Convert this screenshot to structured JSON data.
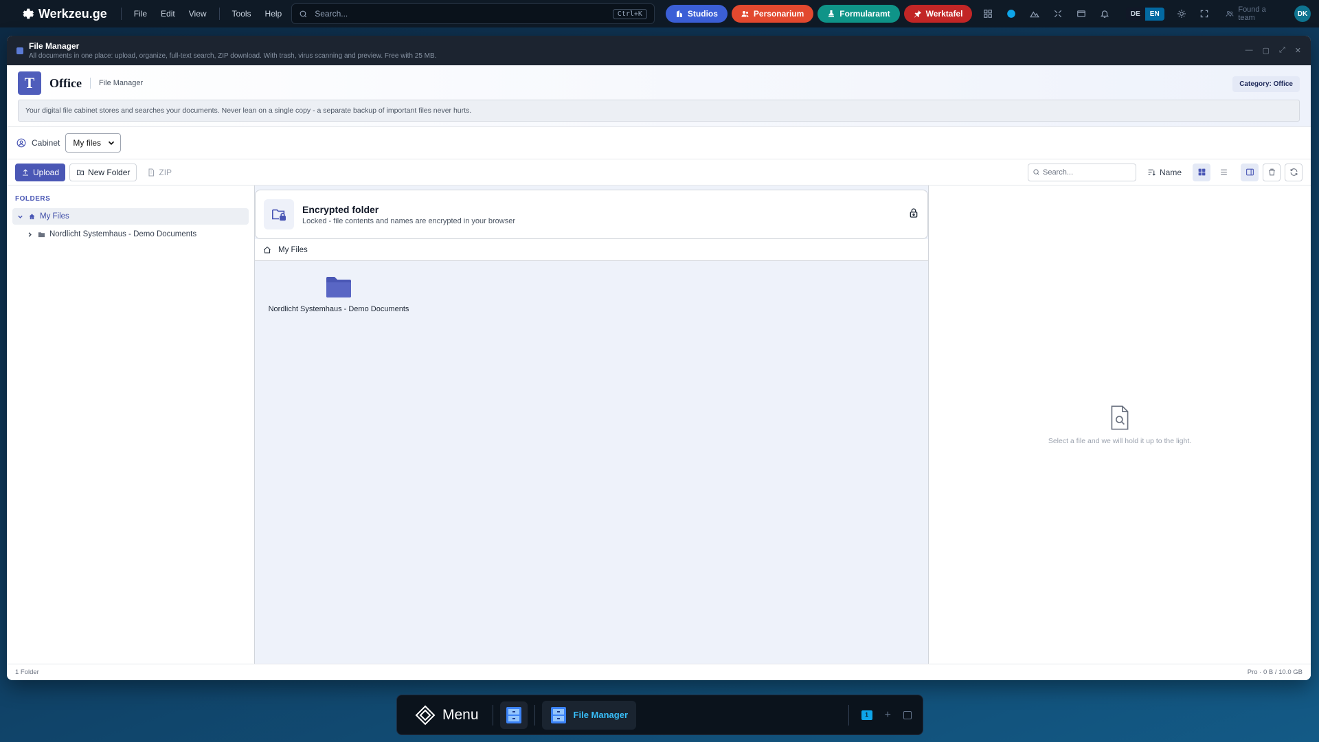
{
  "topbar": {
    "brand": "Werkzeu.ge",
    "menus": [
      "File",
      "Edit",
      "View",
      "Tools",
      "Help"
    ],
    "search_placeholder": "Search...",
    "search_shortcut": "Ctrl+K",
    "pills": [
      {
        "label": "Studios",
        "color": "#3b5fd6"
      },
      {
        "label": "Personarium",
        "color": "#e2492f"
      },
      {
        "label": "Formularamt",
        "color": "#0f9488"
      },
      {
        "label": "Werktafel",
        "color": "#c22626"
      }
    ],
    "lang_de": "DE",
    "lang_en": "EN",
    "found_team": "Found a team",
    "avatar_initials": "DK"
  },
  "window": {
    "title": "File Manager",
    "subtitle": "All documents in one place: upload, organize, full-text search, ZIP download. With trash, virus scanning and preview. Free with 25 MB."
  },
  "header": {
    "badge_letter": "T",
    "app_name": "Office",
    "app_sub": "File Manager",
    "category": "Category: Office",
    "notice": "Your digital file cabinet stores and searches your documents. Never lean on a single copy - a separate backup of important files never hurts."
  },
  "cabinet": {
    "label": "Cabinet",
    "selected": "My files"
  },
  "toolbar": {
    "upload": "Upload",
    "new_folder": "New Folder",
    "zip": "ZIP",
    "search_placeholder": "Search...",
    "sort_label": "Name"
  },
  "sidebar": {
    "title": "FOLDERS",
    "root": "My Files",
    "children": [
      "Nordlicht Systemhaus - Demo Documents"
    ]
  },
  "main": {
    "enc_title": "Encrypted folder",
    "enc_sub": "Locked - file contents and names are encrypted in your browser",
    "breadcrumb": "My Files",
    "items": [
      {
        "name": "Nordlicht Systemhaus - Demo Documents",
        "type": "folder"
      }
    ]
  },
  "preview": {
    "empty_text": "Select a file and we will hold it up to the light."
  },
  "status": {
    "left": "1 Folder",
    "right": "Pro · 0 B / 10.0 GB"
  },
  "dock": {
    "menu": "Menu",
    "active_app": "File Manager",
    "workspace": "1"
  },
  "colors": {
    "accent": "#4a57b5",
    "topbar_bg": "#0f1a26",
    "window_title_bg": "#1c2430"
  }
}
